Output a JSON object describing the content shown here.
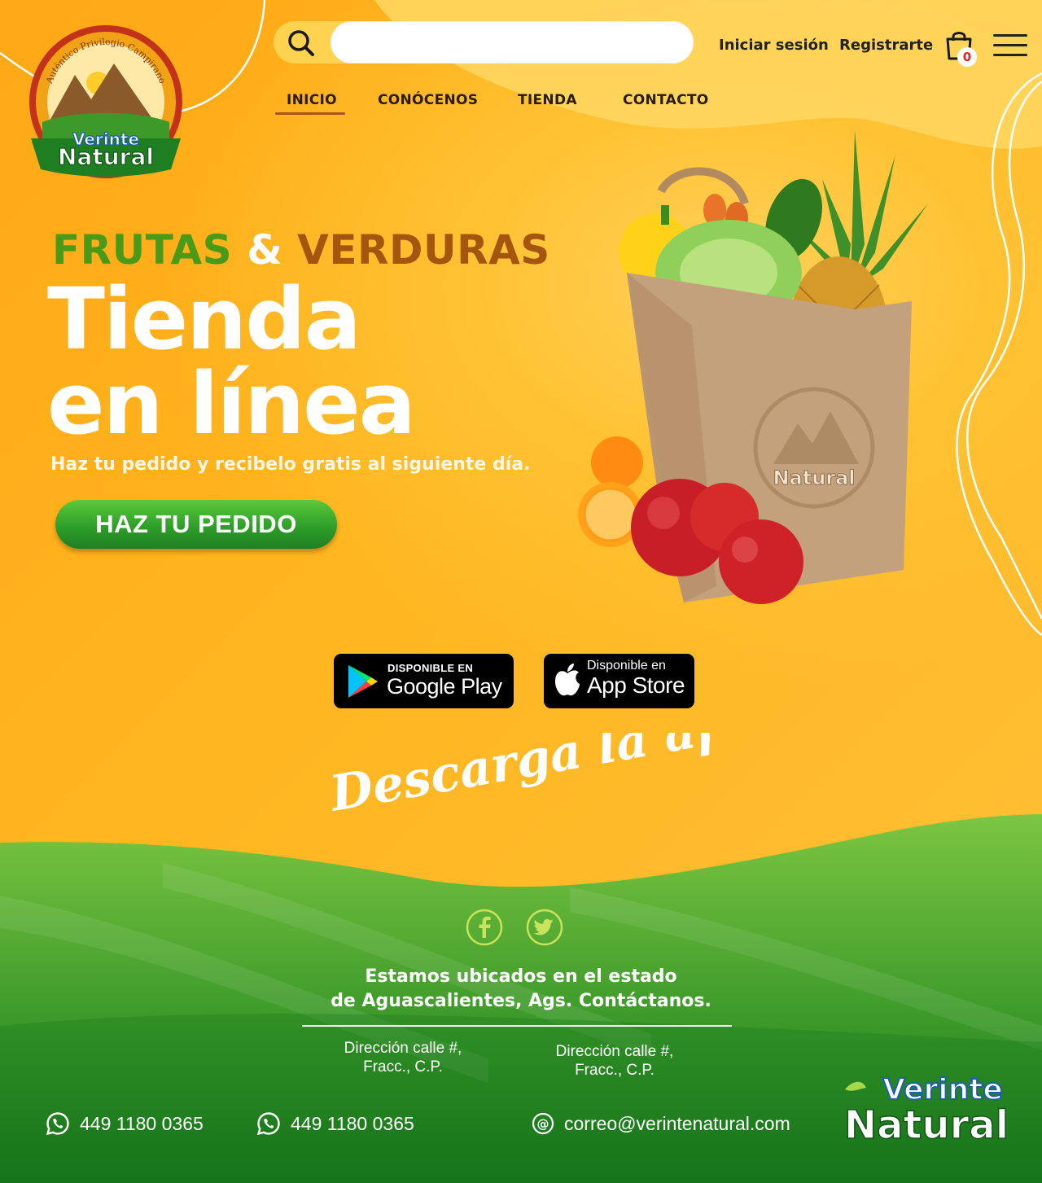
{
  "brand": {
    "logo_arc_text": "Auténtico Privilegio Campirano",
    "name_line1": "Verinte",
    "name_line2": "Natural"
  },
  "header": {
    "search_placeholder": "",
    "login_label": "Iniciar sesión",
    "register_label": "Registrarte",
    "cart_count": "0",
    "cart_icon": "shopping-bag-icon",
    "menu_icon": "hamburger-menu-icon"
  },
  "nav": {
    "items": [
      {
        "label": "INICIO",
        "active": true
      },
      {
        "label": "CONÓCENOS",
        "active": false
      },
      {
        "label": "TIENDA",
        "active": false
      },
      {
        "label": "CONTACTO",
        "active": false
      }
    ],
    "active_underline_color": "#a8551a"
  },
  "hero": {
    "kicker_part1": "FRUTAS",
    "kicker_amp": "&",
    "kicker_part2": "VERDURAS",
    "title_line1": "Tienda",
    "title_line2": "en línea",
    "subtitle": "Haz tu pedido y recibelo gratis al siguiente día.",
    "cta_label": "HAZ TU PEDIDO",
    "colors": {
      "green": "#4a9a1a",
      "brown": "#a4560f",
      "cta": "#2e9f2a"
    }
  },
  "apps": {
    "google_play": {
      "small": "DISPONIBLE EN",
      "big": "Google Play",
      "icon": "google-play-icon"
    },
    "app_store": {
      "small": "Disponible en",
      "big": "App Store",
      "icon": "apple-icon"
    },
    "tagline": "Descarga la app"
  },
  "footer": {
    "social": [
      {
        "name": "facebook",
        "icon": "facebook-icon"
      },
      {
        "name": "twitter",
        "icon": "twitter-icon"
      }
    ],
    "location_line1": "Estamos ubicados en el estado",
    "location_line2": "de Aguascalientes, Ags. Contáctanos.",
    "addresses": [
      {
        "line1": "Dirección calle  #,",
        "line2": "Fracc., C.P."
      },
      {
        "line1": "Dirección calle  #,",
        "line2": "Fracc., C.P."
      }
    ],
    "phones": [
      "449 1180 0365",
      "449 1180 0365"
    ],
    "email": "correo@verintenatural.com",
    "colors": {
      "green_dark": "#1d7a1b",
      "green_light": "#6ec43a"
    }
  }
}
